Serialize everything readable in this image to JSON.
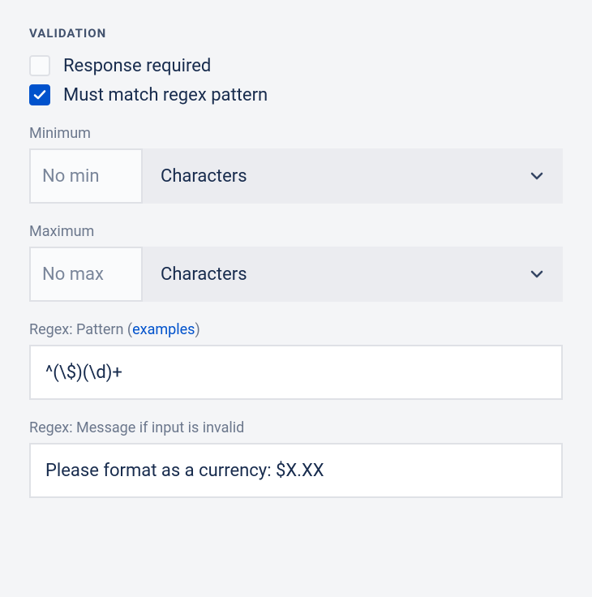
{
  "section": {
    "title": "VALIDATION"
  },
  "checkboxes": {
    "response_required": {
      "label": "Response required",
      "checked": false
    },
    "must_match_regex": {
      "label": "Must match regex pattern",
      "checked": true
    }
  },
  "minimum": {
    "label": "Minimum",
    "placeholder": "No min",
    "value": "",
    "unit_selected": "Characters"
  },
  "maximum": {
    "label": "Maximum",
    "placeholder": "No max",
    "value": "",
    "unit_selected": "Characters"
  },
  "regex_pattern": {
    "label_prefix": "Regex: Pattern (",
    "label_link": "examples",
    "label_suffix": ")",
    "value": "^(\\$)(\\d)+"
  },
  "regex_message": {
    "label": "Regex: Message if input is invalid",
    "value": "Please format as a currency: $X.XX"
  }
}
